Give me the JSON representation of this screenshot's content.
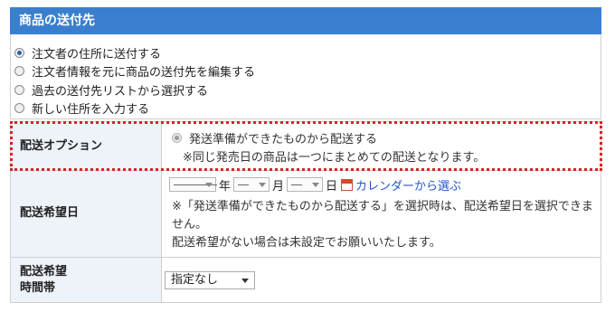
{
  "header": {
    "title": "商品の送付先"
  },
  "address_options": [
    {
      "label": "注文者の住所に送付する",
      "checked": true
    },
    {
      "label": "注文者情報を元に商品の送付先を編集する",
      "checked": false
    },
    {
      "label": "過去の送付先リストから選択する",
      "checked": false
    },
    {
      "label": "新しい住所を入力する",
      "checked": false
    }
  ],
  "shipping_option": {
    "label": "配送オプション",
    "radio_label": "発送準備ができたものから配送する",
    "note": "※同じ発売日の商品は一つにまとめての配送となります。",
    "highlight_color": "#d72323"
  },
  "delivery_date": {
    "label": "配送希望日",
    "year_value": "――――",
    "year_unit": "年",
    "month_value": "―",
    "month_unit": "月",
    "day_value": "―",
    "day_unit": "日",
    "calendar_link": "カレンダーから選ぶ",
    "note_line1": "※「発送準備ができたものから配送する」を選択時は、配送希望日を選択できま",
    "note_line2": "せん。",
    "note_line3": "配送希望がない場合は未設定でお願いいたします。"
  },
  "delivery_time": {
    "label_line1": "配送希望",
    "label_line2": "時間帯",
    "selected": "指定なし"
  },
  "colors": {
    "header_bg": "#3a7fcf",
    "label_bg": "#eef2f9",
    "link": "#2355c8"
  }
}
